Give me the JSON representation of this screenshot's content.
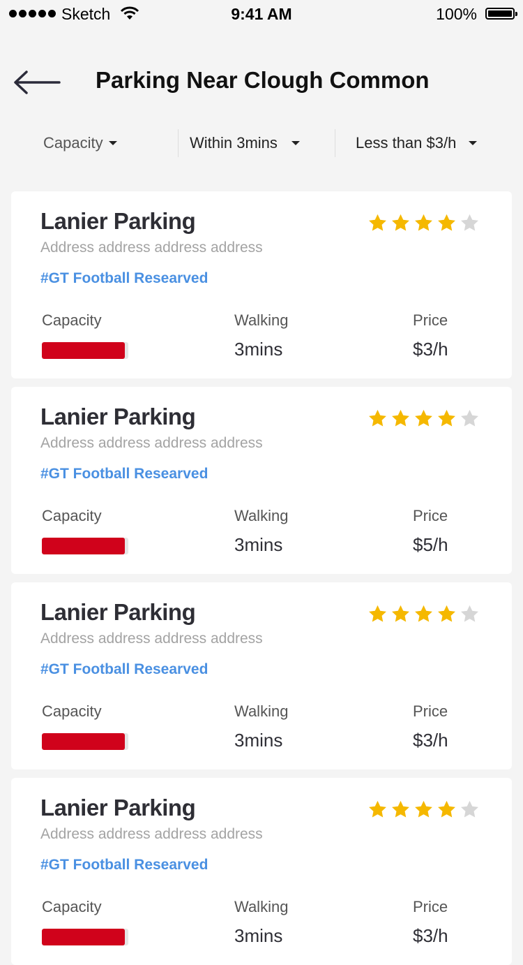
{
  "status_bar": {
    "carrier": "Sketch",
    "time": "9:41 AM",
    "battery": "100%"
  },
  "header": {
    "title": "Parking Near Clough Common",
    "back_icon": "arrow-left-icon"
  },
  "filters": [
    {
      "label": "Capacity"
    },
    {
      "label": "Within 3mins"
    },
    {
      "label": "Less than $3/h"
    }
  ],
  "colors": {
    "star_on": "#f5b800",
    "star_off": "#d6d6d6",
    "tag": "#4a90e2",
    "capacity_bar": "#d0021b"
  },
  "labels": {
    "capacity": "Capacity",
    "walking": "Walking",
    "price": "Price"
  },
  "lots": [
    {
      "name": "Lanier Parking",
      "address": "Address address address address",
      "tag": "#GT Football Researved",
      "rating": 4,
      "capacity_fill": 0.96,
      "walking": "3mins",
      "price": "$3/h"
    },
    {
      "name": "Lanier Parking",
      "address": "Address address address address",
      "tag": "#GT Football Researved",
      "rating": 4,
      "capacity_fill": 0.96,
      "walking": "3mins",
      "price": "$5/h"
    },
    {
      "name": "Lanier Parking",
      "address": "Address address address address",
      "tag": "#GT Football Researved",
      "rating": 4,
      "capacity_fill": 0.96,
      "walking": "3mins",
      "price": "$3/h"
    },
    {
      "name": "Lanier Parking",
      "address": "Address address address address",
      "tag": "#GT Football Researved",
      "rating": 4,
      "capacity_fill": 0.96,
      "walking": "3mins",
      "price": "$3/h"
    }
  ]
}
